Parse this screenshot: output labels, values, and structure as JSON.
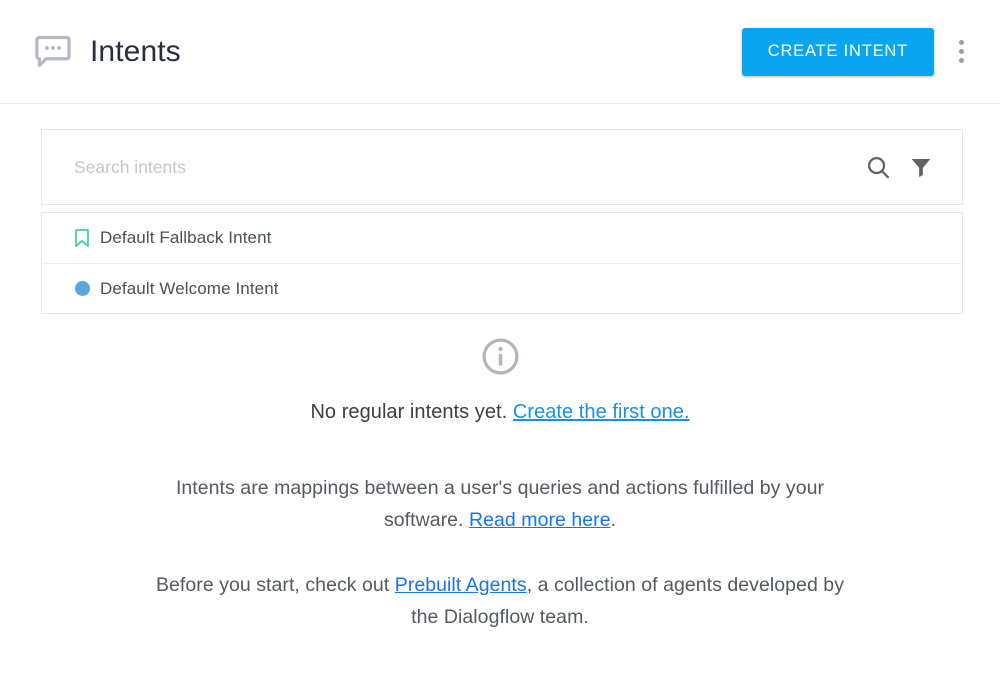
{
  "header": {
    "icon": "chat-bubble-icon",
    "title": "Intents",
    "create_button_label": "CREATE INTENT",
    "overflow_menu": "more-options-icon",
    "accent_color": "#08a6f0",
    "title_color": "#262f3d"
  },
  "search": {
    "placeholder": "Search intents",
    "value": "",
    "search_icon": "search-icon",
    "filter_icon": "filter-icon"
  },
  "intent_list": {
    "items": [
      {
        "name": "Default Fallback Intent",
        "badge": "bookmark-icon",
        "badge_color": "#4bceac"
      },
      {
        "name": "Default Welcome Intent",
        "badge": "blue-dot",
        "badge_color": "#5da4e0"
      }
    ]
  },
  "empty_state": {
    "icon": "info-icon",
    "headline_text": "No regular intents yet. ",
    "headline_link": "Create the first one.",
    "paragraph1_before": "Intents are mappings between a user's queries and actions fulfilled by your software. ",
    "paragraph1_link": "Read more here",
    "paragraph1_after": ".",
    "paragraph2_before": "Before you start, check out ",
    "paragraph2_link": "Prebuilt Agents",
    "paragraph2_after": ", a collection of agents developed by the Dialogflow team.",
    "link_color": "#1a73e8"
  }
}
